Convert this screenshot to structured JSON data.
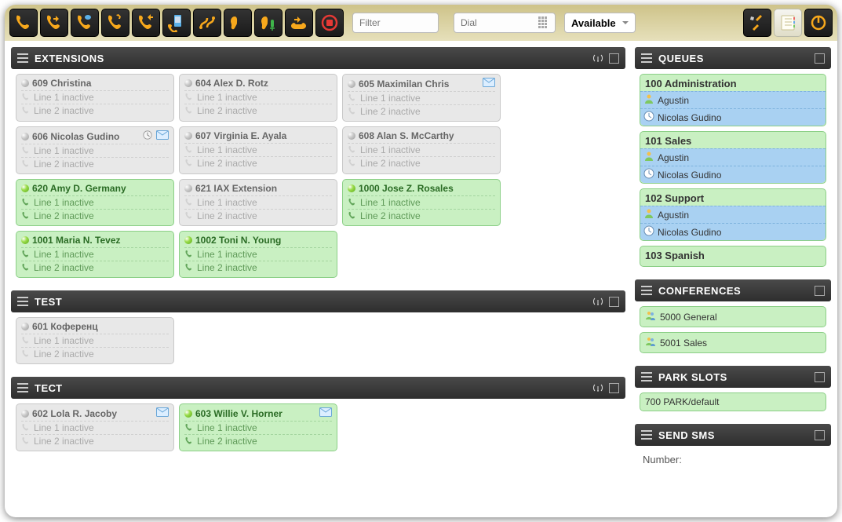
{
  "toolbar": {
    "filter_placeholder": "Filter",
    "dial_placeholder": "Dial",
    "status": "Available",
    "buttons": [
      "phone",
      "hold",
      "transfer",
      "voicemail",
      "redirect",
      "mobile",
      "callpath",
      "listen",
      "whisper",
      "barge",
      "stop"
    ],
    "right_buttons": [
      "settings",
      "contacts",
      "power"
    ]
  },
  "panels": {
    "extensions": {
      "title": "EXTENSIONS",
      "items": [
        {
          "num": "609",
          "name": "Christina",
          "active": false,
          "bold": true,
          "badges": [],
          "lines": [
            "Line 1 inactive",
            "Line 2 inactive"
          ]
        },
        {
          "num": "604",
          "name": "Alex D. Rotz",
          "active": false,
          "badges": [],
          "lines": [
            "Line 1 inactive",
            "Line 2 inactive"
          ]
        },
        {
          "num": "605",
          "name": "Maximilan Chris",
          "active": false,
          "badges": [
            "mail"
          ],
          "lines": [
            "Line 1 inactive",
            "Line 2 inactive"
          ]
        },
        {
          "num": "606",
          "name": "Nicolas Gudino",
          "active": false,
          "badges": [
            "clock",
            "mail"
          ],
          "lines": [
            "Line 1 inactive",
            "Line 2 inactive"
          ]
        },
        {
          "num": "607",
          "name": "Virginia E. Ayala",
          "active": false,
          "badges": [],
          "lines": [
            "Line 1 inactive",
            "Line 2 inactive"
          ]
        },
        {
          "num": "608",
          "name": "Alan S. McCarthy",
          "active": false,
          "badges": [],
          "lines": [
            "Line 1 inactive",
            "Line 2 inactive"
          ]
        },
        {
          "num": "620",
          "name": "Amy D. Germany",
          "active": true,
          "badges": [],
          "lines": [
            "Line 1 inactive",
            "Line 2 inactive"
          ]
        },
        {
          "num": "621",
          "name": "IAX Extension",
          "active": false,
          "badges": [],
          "lines": [
            "Line 1 inactive",
            "Line 2 inactive"
          ]
        },
        {
          "num": "1000",
          "name": "Jose Z. Rosales",
          "active": true,
          "badges": [],
          "lines": [
            "Line 1 inactive",
            "Line 2 inactive"
          ]
        },
        {
          "num": "1001",
          "name": "Maria N. Tevez",
          "active": true,
          "badges": [],
          "lines": [
            "Line 1 inactive",
            "Line 2 inactive"
          ]
        },
        {
          "num": "1002",
          "name": "Toni N. Young",
          "active": true,
          "badges": [],
          "lines": [
            "Line 1 inactive",
            "Line 2 inactive"
          ]
        }
      ]
    },
    "test": {
      "title": "TEST",
      "items": [
        {
          "num": "601",
          "name": "Коференц",
          "active": false,
          "badges": [],
          "lines": [
            "Line 1 inactive",
            "Line 2 inactive"
          ]
        }
      ]
    },
    "tect": {
      "title": "ТЕСТ",
      "items": [
        {
          "num": "602",
          "name": "Lola R. Jacoby",
          "active": false,
          "badges": [
            "mail"
          ],
          "lines": [
            "Line 1 inactive",
            "Line 2 inactive"
          ]
        },
        {
          "num": "603",
          "name": "Willie V. Horner",
          "active": true,
          "badges": [
            "mail"
          ],
          "lines": [
            "Line 1 inactive",
            "Line 2 inactive"
          ]
        }
      ]
    },
    "queues": {
      "title": "QUEUES",
      "items": [
        {
          "num": "100",
          "name": "Administration",
          "members": [
            {
              "icon": "person",
              "name": "Agustin"
            },
            {
              "icon": "clock",
              "name": "Nicolas Gudino"
            }
          ]
        },
        {
          "num": "101",
          "name": "Sales",
          "members": [
            {
              "icon": "person",
              "name": "Agustin"
            },
            {
              "icon": "clock",
              "name": "Nicolas Gudino"
            }
          ]
        },
        {
          "num": "102",
          "name": "Support",
          "members": [
            {
              "icon": "person",
              "name": "Agustin"
            },
            {
              "icon": "clock",
              "name": "Nicolas Gudino"
            }
          ]
        },
        {
          "num": "103",
          "name": "Spanish",
          "members": []
        }
      ]
    },
    "conferences": {
      "title": "CONFERENCES",
      "items": [
        {
          "num": "5000",
          "name": "General"
        },
        {
          "num": "5001",
          "name": "Sales"
        }
      ]
    },
    "parkslots": {
      "title": "PARK SLOTS",
      "items": [
        {
          "num": "700",
          "name": "PARK/default"
        }
      ]
    },
    "sendsms": {
      "title": "SEND SMS",
      "number_label": "Number:"
    }
  }
}
